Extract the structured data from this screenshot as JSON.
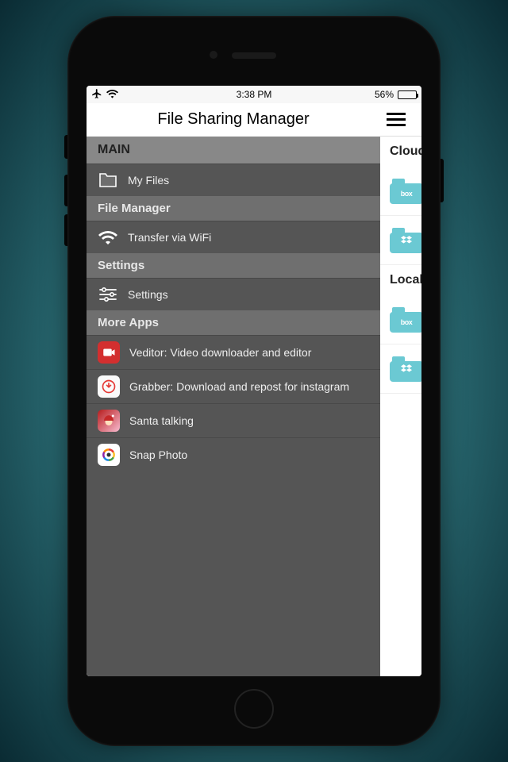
{
  "status": {
    "time": "3:38 PM",
    "battery_pct": "56%",
    "battery_fill": "56%"
  },
  "drawer": {
    "title": "File Sharing Manager",
    "main_header": "MAIN",
    "items": {
      "my_files": "My Files"
    },
    "file_manager_header": "File Manager",
    "transfer": "Transfer via WiFi",
    "settings_header": "Settings",
    "settings_item": "Settings",
    "more_apps_header": "More Apps",
    "apps": {
      "veditor": "Veditor: Video downloader and editor",
      "grabber": "Grabber: Download and repost for instagram",
      "santa": "Santa talking",
      "snap": "Snap Photo"
    }
  },
  "main": {
    "section_cloud": "Cloud",
    "section_local": "Local"
  }
}
